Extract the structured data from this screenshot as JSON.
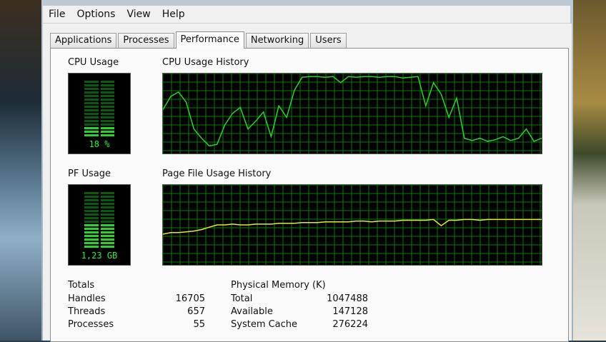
{
  "menu": [
    "File",
    "Options",
    "View",
    "Help"
  ],
  "tabs": [
    "Applications",
    "Processes",
    "Performance",
    "Networking",
    "Users"
  ],
  "active_tab": "Performance",
  "cpu_usage": {
    "label": "CPU Usage",
    "value_text": "18 %",
    "level": 0.18
  },
  "cpu_history": {
    "label": "CPU Usage History",
    "line_color": "#2dd12d"
  },
  "pf_usage": {
    "label": "PF Usage",
    "value_text": "1,23 GB",
    "level": 0.45
  },
  "pf_history": {
    "label": "Page File Usage History",
    "line_color": "#e8e832"
  },
  "totals": {
    "title": "Totals",
    "rows": [
      {
        "label": "Handles",
        "value": "16705"
      },
      {
        "label": "Threads",
        "value": "657"
      },
      {
        "label": "Processes",
        "value": "55"
      }
    ]
  },
  "physical_memory": {
    "title": "Physical Memory (K)",
    "rows": [
      {
        "label": "Total",
        "value": "1047488"
      },
      {
        "label": "Available",
        "value": "147128"
      },
      {
        "label": "System Cache",
        "value": "276224"
      }
    ]
  },
  "colors": {
    "graph_bg": "#000000",
    "grid": "#0a7a0a",
    "meter_on": "#2dd12d",
    "meter_off": "#0b5a10"
  },
  "chart_data": [
    {
      "type": "line",
      "series": [
        {
          "values": [
            55,
            72,
            78,
            65,
            30,
            18,
            8,
            10,
            35,
            50,
            58,
            30,
            40,
            52,
            20,
            60,
            45,
            80,
            97,
            98,
            98,
            97,
            98,
            90,
            98,
            97,
            98,
            98,
            97,
            98,
            98,
            96,
            97,
            98,
            60,
            90,
            75,
            45,
            70,
            18,
            15,
            18,
            14,
            16,
            20,
            15,
            18,
            30,
            14,
            18
          ]
        }
      ],
      "ylim": [
        0,
        100
      ]
    },
    {
      "type": "line",
      "series": [
        {
          "values": [
            38,
            40,
            40,
            41,
            42,
            44,
            47,
            50,
            50,
            51,
            50,
            50,
            51,
            51,
            51,
            52,
            52,
            52,
            53,
            53,
            53,
            54,
            54,
            54,
            54,
            55,
            55,
            54,
            55,
            55,
            55,
            56,
            56,
            56,
            56,
            57,
            49,
            56,
            56,
            57,
            57,
            56,
            57,
            57,
            57,
            57,
            57,
            57,
            57,
            57
          ]
        }
      ],
      "ylim": [
        0,
        100
      ]
    }
  ]
}
